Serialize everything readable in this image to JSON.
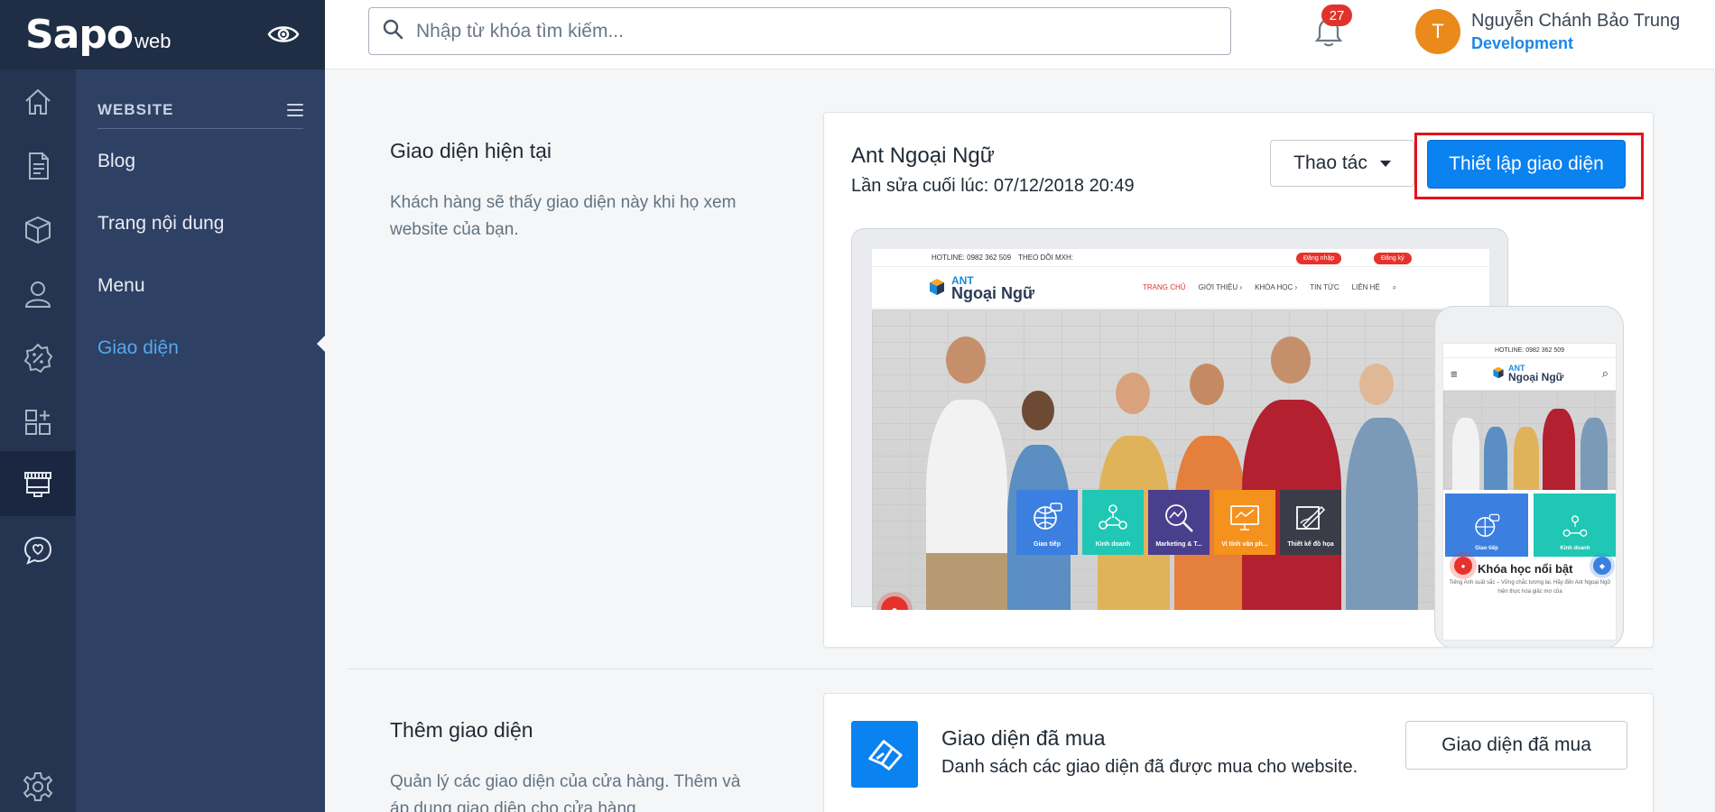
{
  "brand": {
    "logo_main": "Sapo",
    "logo_sub": "web"
  },
  "rail": {
    "items": [
      {
        "name": "home-icon"
      },
      {
        "name": "orders-icon"
      },
      {
        "name": "products-icon"
      },
      {
        "name": "customers-icon"
      },
      {
        "name": "discount-icon"
      },
      {
        "name": "apps-icon"
      },
      {
        "name": "store-icon",
        "active": true
      },
      {
        "name": "chat-heart-icon"
      },
      {
        "name": "settings-icon"
      }
    ]
  },
  "subnav": {
    "title": "WEBSITE",
    "items": [
      {
        "label": "Blog"
      },
      {
        "label": "Trang nội dung"
      },
      {
        "label": "Menu"
      },
      {
        "label": "Giao diện",
        "active": true
      }
    ]
  },
  "topbar": {
    "search_placeholder": "Nhập từ khóa tìm kiếm...",
    "notification_count": "27",
    "user_initial": "T",
    "user_name": "Nguyễn Chánh Bảo Trung",
    "user_role": "Development"
  },
  "current_theme": {
    "section_title": "Giao diện hiện tại",
    "section_desc": "Khách hàng sẽ thấy giao diện này khi họ xem website của bạn.",
    "theme_name": "Ant Ngoại Ngữ",
    "last_edited": "Lần sửa cuối lúc: 07/12/2018 20:49",
    "actions_label": "Thao tác",
    "customize_label": "Thiết lập giao diện",
    "preview": {
      "hotline": "HOTLINE: 0982 362 509",
      "follow": "THEO DÕI MXH:",
      "login": "Đăng nhập",
      "register": "Đăng ký",
      "logo_top": "ANT",
      "logo_bottom": "Ngoại Ngữ",
      "menu": [
        "TRANG CHỦ",
        "GIỚI THIỆU ›",
        "KHÓA HỌC ›",
        "TIN TỨC",
        "LIÊN HỆ"
      ],
      "tiles": [
        {
          "label": "Giao tiếp",
          "color": "#3b7fe0"
        },
        {
          "label": "Kinh doanh",
          "color": "#1fc7b4"
        },
        {
          "label": "Marketing & T...",
          "color": "#4a3f8c"
        },
        {
          "label": "Vi tính văn ph...",
          "color": "#f5921e"
        },
        {
          "label": "Thiết kế đồ họa",
          "color": "#3a3d48"
        }
      ],
      "mobile_hotline": "HOTLINE: 0982 362 509",
      "mobile_featured": "Khóa học nổi bật",
      "mobile_text": "Tiếng Anh suất sắc – Vững chắc tương lai. Hãy đến Ant Ngoại Ngữ hiện thực hóa giấc mơ của"
    }
  },
  "add_theme": {
    "section_title": "Thêm giao diện",
    "section_desc": "Quản lý các giao diện của cửa hàng. Thêm và áp dụng giao diện cho cửa hàng",
    "bought_title": "Giao diện đã mua",
    "bought_desc": "Danh sách các giao diện đã được mua cho website.",
    "bought_button": "Giao diện đã mua"
  },
  "colors": {
    "primary": "#0a82f0",
    "sidebar": "#253551",
    "subnav": "#2e4063",
    "highlight": "#e3131b",
    "badge": "#e0332b",
    "avatar": "#e98a1a"
  }
}
